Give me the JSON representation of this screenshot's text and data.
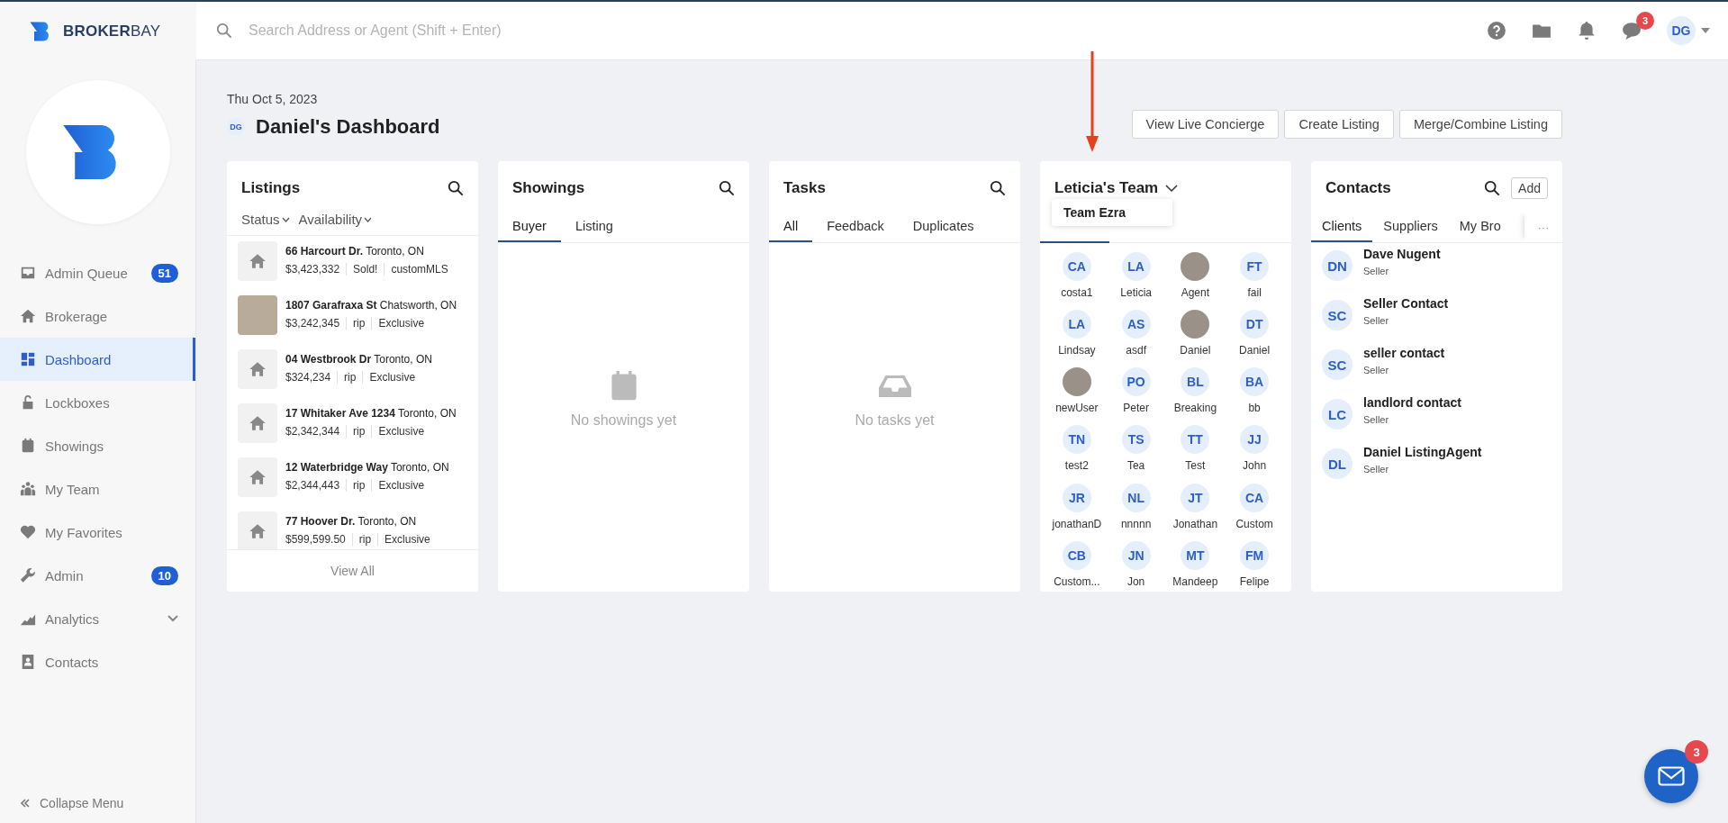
{
  "brand": {
    "bold": "BROKER",
    "light": "BAY"
  },
  "search": {
    "placeholder": "Search Address or Agent (Shift + Enter)"
  },
  "header": {
    "chat_badge": "3",
    "user_initials": "DG"
  },
  "sidebar": {
    "items": [
      {
        "label": "Admin Queue",
        "badge": "51",
        "selected": false,
        "expandable": false
      },
      {
        "label": "Brokerage",
        "selected": false,
        "expandable": false
      },
      {
        "label": "Dashboard",
        "selected": true,
        "expandable": false
      },
      {
        "label": "Lockboxes",
        "selected": false,
        "expandable": false
      },
      {
        "label": "Showings",
        "selected": false,
        "expandable": false
      },
      {
        "label": "My Team",
        "selected": false,
        "expandable": false
      },
      {
        "label": "My Favorites",
        "selected": false,
        "expandable": false
      },
      {
        "label": "Admin",
        "badge": "10",
        "selected": false,
        "expandable": false
      },
      {
        "label": "Analytics",
        "selected": false,
        "expandable": true
      },
      {
        "label": "Contacts",
        "selected": false,
        "expandable": false
      }
    ],
    "collapse_label": "Collapse Menu"
  },
  "page": {
    "date": "Thu Oct 5, 2023",
    "user_initials": "DG",
    "title": "Daniel's Dashboard",
    "actions": [
      "View Live Concierge",
      "Create Listing",
      "Merge/Combine Listing"
    ]
  },
  "listings": {
    "title": "Listings",
    "filters": [
      "Status",
      "Availability"
    ],
    "items": [
      {
        "kind": "icon",
        "address": "66 Harcourt Dr.",
        "city": "Toronto, ON",
        "price": "$3,423,332",
        "status": "Sold!",
        "type": "customMLS"
      },
      {
        "kind": "photo",
        "address": "1807 Garafraxa St",
        "city": "Chatsworth, ON",
        "price": "$3,242,345",
        "status": "rip",
        "type": "Exclusive"
      },
      {
        "kind": "icon",
        "address": "04 Westbrook Dr",
        "city": "Toronto, ON",
        "price": "$324,234",
        "status": "rip",
        "type": "Exclusive"
      },
      {
        "kind": "icon",
        "address": "17 Whitaker Ave 1234",
        "city": "Toronto, ON",
        "price": "$2,342,344",
        "status": "rip",
        "type": "Exclusive"
      },
      {
        "kind": "icon",
        "address": "12 Waterbridge Way",
        "city": "Toronto, ON",
        "price": "$2,344,443",
        "status": "rip",
        "type": "Exclusive"
      },
      {
        "kind": "icon",
        "address": "77 Hoover Dr.",
        "city": "Toronto, ON",
        "price": "$599,599.50",
        "status": "rip",
        "type": "Exclusive"
      }
    ],
    "footer": "View All"
  },
  "showings": {
    "title": "Showings",
    "tabs": [
      {
        "label": "Buyer",
        "selected": true
      },
      {
        "label": "Listing",
        "selected": false
      }
    ],
    "empty_text": "No showings yet"
  },
  "tasks": {
    "title": "Tasks",
    "tabs": [
      {
        "label": "All",
        "selected": true
      },
      {
        "label": "Feedback",
        "selected": false
      },
      {
        "label": "Duplicates",
        "selected": false
      }
    ],
    "empty_text": "No tasks yet"
  },
  "team": {
    "title": "Leticia's Team",
    "dropdown_option": "Team Ezra",
    "members": [
      {
        "kind": "initials",
        "initials": "CA",
        "name": "costa1"
      },
      {
        "kind": "initials",
        "initials": "LA",
        "name": "Leticia"
      },
      {
        "kind": "photo",
        "name": "Agent"
      },
      {
        "kind": "initials",
        "initials": "FT",
        "name": "fail"
      },
      {
        "kind": "initials",
        "initials": "LA",
        "name": "Lindsay"
      },
      {
        "kind": "initials",
        "initials": "AS",
        "name": "asdf"
      },
      {
        "kind": "photo",
        "name": "Daniel"
      },
      {
        "kind": "initials",
        "initials": "DT",
        "name": "Daniel"
      },
      {
        "kind": "photo",
        "name": "newUser"
      },
      {
        "kind": "initials",
        "initials": "PO",
        "name": "Peter"
      },
      {
        "kind": "initials",
        "initials": "BL",
        "name": "Breaking"
      },
      {
        "kind": "initials",
        "initials": "BA",
        "name": "bb"
      },
      {
        "kind": "initials",
        "initials": "TN",
        "name": "test2"
      },
      {
        "kind": "initials",
        "initials": "TS",
        "name": "Tea"
      },
      {
        "kind": "initials",
        "initials": "TT",
        "name": "Test"
      },
      {
        "kind": "initials",
        "initials": "JJ",
        "name": "John"
      },
      {
        "kind": "initials",
        "initials": "JR",
        "name": "jonathanD"
      },
      {
        "kind": "initials",
        "initials": "NL",
        "name": "nnnnn"
      },
      {
        "kind": "initials",
        "initials": "JT",
        "name": "Jonathan"
      },
      {
        "kind": "initials",
        "initials": "CA",
        "name": "Custom"
      },
      {
        "kind": "initials",
        "initials": "CB",
        "name": "Custom..."
      },
      {
        "kind": "initials",
        "initials": "JN",
        "name": "Jon"
      },
      {
        "kind": "initials",
        "initials": "MT",
        "name": "Mandeep"
      },
      {
        "kind": "initials",
        "initials": "FM",
        "name": "Felipe"
      }
    ]
  },
  "contacts": {
    "title": "Contacts",
    "add_label": "Add",
    "tabs": [
      {
        "label": "Clients",
        "selected": true
      },
      {
        "label": "Suppliers",
        "selected": false
      },
      {
        "label": "My Bro",
        "selected": false
      }
    ],
    "more": "···",
    "items": [
      {
        "initials": "DN",
        "name": "Dave Nugent",
        "role": "Seller"
      },
      {
        "initials": "SC",
        "name": "Seller Contact",
        "role": "Seller"
      },
      {
        "initials": "SC",
        "name": "seller contact",
        "role": "Seller"
      },
      {
        "initials": "LC",
        "name": "landlord contact",
        "role": "Seller"
      },
      {
        "initials": "DL",
        "name": "Daniel ListingAgent",
        "role": "Seller"
      }
    ]
  },
  "chat_widget": {
    "badge": "3"
  }
}
